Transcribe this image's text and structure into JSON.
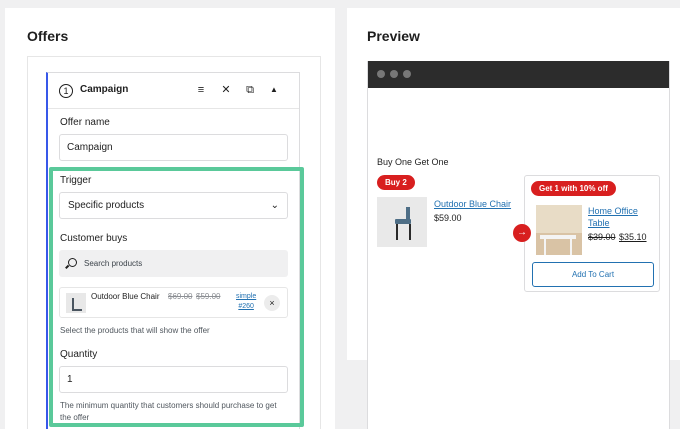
{
  "offers_panel": {
    "title": "Offers",
    "campaign": {
      "step": "1",
      "title": "Campaign",
      "icons": [
        "menu-icon",
        "close-icon",
        "duplicate-icon",
        "collapse-icon"
      ]
    },
    "offer_name": {
      "label": "Offer name",
      "value": "Campaign"
    },
    "trigger": {
      "label": "Trigger",
      "selected": "Specific products"
    },
    "customer_buys": {
      "label": "Customer buys",
      "search_placeholder": "Search products",
      "product": {
        "name": "Outdoor Blue Chair",
        "price_old": "$69.00",
        "price_new": "$59.00",
        "sku_line1": "simple",
        "sku_line2": "#260",
        "remove": "×"
      },
      "help": "Select the products that will show the offer"
    },
    "quantity": {
      "label": "Quantity",
      "value": "1",
      "help": "The minimum quantity that customers should purchase to get the offer"
    }
  },
  "preview_panel": {
    "title": "Preview",
    "heading": "Buy One Get One",
    "buy_badge": "Buy 2",
    "buy_product": {
      "name": "Outdoor Blue Chair",
      "price": "$59.00"
    },
    "get_badge": "Get 1 with 10% off",
    "get_product": {
      "name_line1": "Home Office",
      "name_line2": "Table",
      "price_old": "$39.00",
      "price_new": "$35.10"
    },
    "add_to_cart": "Add To Cart",
    "arrow": "→"
  },
  "colors": {
    "accent_blue": "#3858e9",
    "highlight_green": "#5ac99a",
    "badge_red": "#d81f1f",
    "link_blue": "#2271b1"
  }
}
